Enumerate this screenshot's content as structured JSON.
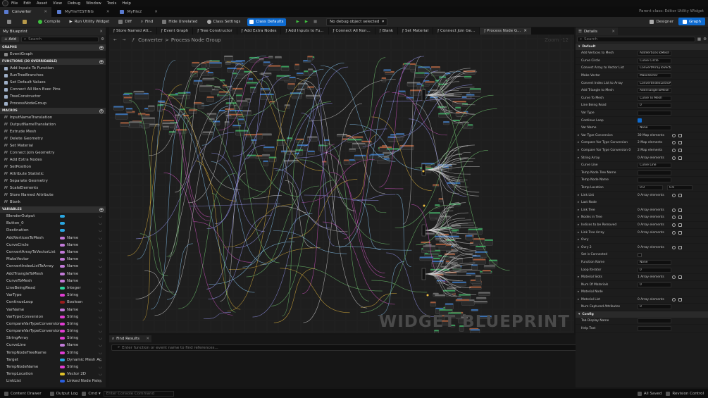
{
  "menu": [
    "File",
    "Edit",
    "Asset",
    "View",
    "Debug",
    "Window",
    "Tools",
    "Help"
  ],
  "doc_tabs": [
    {
      "label": "Converter",
      "active": true
    },
    {
      "label": "MyFileTESTING",
      "active": false
    },
    {
      "label": "MyFile2",
      "active": false
    }
  ],
  "parent_class": "Parent class: Editor Utility Widget",
  "toolbar": {
    "compile": "Compile",
    "run": "Run Utility Widget",
    "diff": "Diff",
    "find": "Find",
    "hide_unrelated": "Hide Unrelated",
    "class_settings": "Class Settings",
    "class_defaults": "Class Defaults",
    "debug_select": "No debug object selected",
    "designer": "Designer",
    "graph": "Graph"
  },
  "my_blueprint": {
    "tab": "My Blueprint",
    "add": "+ Add",
    "search_placeholder": "Search",
    "graphs_header": "GRAPHS",
    "graphs": [
      "EventGraph"
    ],
    "functions_header": "FUNCTIONS (30 OVERRIDABLE)",
    "functions": [
      "Add Inputs To Function",
      "RunTreeBranches",
      "Set Default Values",
      "Connect All Non Exec Pins",
      "TreeConstructor",
      "ProcessNodeGroup"
    ],
    "macros_header": "MACROS",
    "macros": [
      "InputNameTranslation",
      "OutputNameTranslation",
      "Extrude Mesh",
      "Delete Geometry",
      "Set Material",
      "Connect Join Geometry",
      "Add Extra Nodes",
      "SetPosition",
      "Attribute Statistic",
      "Separate Geometry",
      "ScaleElements",
      "Store Named Attribute",
      "Blank"
    ],
    "variables_header": "VARIABLES",
    "variables": [
      {
        "name": "BlenderOutput",
        "type": "",
        "color": "#2aa6e0"
      },
      {
        "name": "Button_0",
        "type": "",
        "color": "#2aa6e0"
      },
      {
        "name": "Destination",
        "type": "",
        "color": "#2aa6e0"
      },
      {
        "name": "AddVerticesToMesh",
        "type": "Name",
        "color": "#c27ad8"
      },
      {
        "name": "CurveCircle",
        "type": "Name",
        "color": "#c27ad8"
      },
      {
        "name": "ConvertArrayToVectorList",
        "type": "Name",
        "color": "#c27ad8"
      },
      {
        "name": "MakeVector",
        "type": "Name",
        "color": "#c27ad8"
      },
      {
        "name": "ConvertIndexListToArray",
        "type": "Name",
        "color": "#c27ad8"
      },
      {
        "name": "AddTriangleToMesh",
        "type": "Name",
        "color": "#c27ad8"
      },
      {
        "name": "CurveToMesh",
        "type": "Name",
        "color": "#c27ad8"
      },
      {
        "name": "LineBeingRead",
        "type": "Integer",
        "color": "#2fd39c"
      },
      {
        "name": "VarType",
        "type": "String",
        "color": "#e03dd2"
      },
      {
        "name": "ContinueLoop",
        "type": "Boolean",
        "color": "#9a1c1c"
      },
      {
        "name": "VarName",
        "type": "Name",
        "color": "#c27ad8"
      },
      {
        "name": "VarTypeConversion",
        "type": "String",
        "color": "#e03dd2"
      },
      {
        "name": "CompareVarTypeConversion",
        "type": "String",
        "color": "#e03dd2"
      },
      {
        "name": "CompareVarTypeConversion_0",
        "type": "String",
        "color": "#e03dd2"
      },
      {
        "name": "StringArray",
        "type": "String",
        "color": "#e03dd2"
      },
      {
        "name": "CurveLine",
        "type": "Name",
        "color": "#c27ad8"
      },
      {
        "name": "TempNodeTreeName",
        "type": "String",
        "color": "#e03dd2"
      },
      {
        "name": "Target",
        "type": "Dynamic Mesh Ac",
        "color": "#2aa6e0"
      },
      {
        "name": "TempNodeName",
        "type": "String",
        "color": "#e03dd2"
      },
      {
        "name": "TempLocation",
        "type": "Vector 2D",
        "color": "#e0c22a"
      },
      {
        "name": "LinkList",
        "type": "Linked Node Pairs",
        "color": "#2a5fe0"
      }
    ]
  },
  "graph": {
    "tabs": [
      "Store Named Att...",
      "Event Graph",
      "Tree Constructor",
      "Add Extra Nodes",
      "Add Inputs to Fu...",
      "Connect All Non...",
      "Blank",
      "Set Material",
      "Connect Join Ge...",
      "Process Node G..."
    ],
    "breadcrumb_root": "Converter",
    "breadcrumb_sep": ">",
    "breadcrumb_current": "Process Node Group",
    "zoom": "Zoom -12",
    "watermark": "WIDGET BLUEPRINT"
  },
  "find_results": {
    "tab": "Find Results",
    "placeholder": "Enter function or event name to find references..."
  },
  "details": {
    "tab": "Details",
    "search_placeholder": "Search",
    "default_header": "Default",
    "config_header": "Config",
    "rows": [
      {
        "label": "Add Vertices to Mesh",
        "value": "AddVerticesToMesh",
        "kind": "field"
      },
      {
        "label": "Curve Circle",
        "value": "Curve Circle",
        "kind": "field"
      },
      {
        "label": "Convert Array to Vector List",
        "value": "ConvertArrayToVectorList",
        "kind": "field"
      },
      {
        "label": "Make Vector",
        "value": "MakeVector",
        "kind": "field"
      },
      {
        "label": "Convert Index List to Array",
        "value": "ConvertIndexListToArray",
        "kind": "field"
      },
      {
        "label": "Add Triangle to Mesh",
        "value": "AddTriangleToMesh",
        "kind": "field"
      },
      {
        "label": "Curve To Mesh",
        "value": "Curve To Mesh",
        "kind": "field"
      },
      {
        "label": "Line Being Read",
        "value": "0",
        "kind": "field"
      },
      {
        "label": "Var Type",
        "value": "",
        "kind": "field"
      },
      {
        "label": "Continue Loop",
        "value": "",
        "kind": "check"
      },
      {
        "label": "Var Name",
        "value": "None",
        "kind": "field"
      },
      {
        "label": "Var Type Conversion",
        "value": "30 Map elements",
        "kind": "arr"
      },
      {
        "label": "Compare Var Type Conversion",
        "value": "2 Map elements",
        "kind": "arr"
      },
      {
        "label": "Compare Var Type Conversion 0",
        "value": "2 Map elements",
        "kind": "arr"
      },
      {
        "label": "String Array",
        "value": "0 Array elements",
        "kind": "arr"
      },
      {
        "label": "Curve Line",
        "value": "Curve Line",
        "kind": "field"
      },
      {
        "label": "Temp Node Tree Name",
        "value": "",
        "kind": "field"
      },
      {
        "label": "Temp Node Name",
        "value": "",
        "kind": "field"
      },
      {
        "label": "Temp Location",
        "value": "0.0",
        "value2": "0.0",
        "kind": "vec"
      },
      {
        "label": "Link List",
        "value": "0 Array elements",
        "kind": "arr"
      },
      {
        "label": "Last Node",
        "value": "",
        "kind": "plain"
      },
      {
        "label": "Link Tree",
        "value": "0 Array elements",
        "kind": "arr"
      },
      {
        "label": "Nodes in Tree",
        "value": "0 Array elements",
        "kind": "arr"
      },
      {
        "label": "Indices to be Removed",
        "value": "0 Array elements",
        "kind": "arr"
      },
      {
        "label": "Link Tree Array",
        "value": "0 Array elements",
        "kind": "arr"
      },
      {
        "label": "Ovry",
        "value": "",
        "kind": "plain"
      },
      {
        "label": "Ovry 2",
        "value": "0 Array elements",
        "kind": "arr"
      },
      {
        "label": "Set is Connected",
        "value": "",
        "kind": "checkoff"
      },
      {
        "label": "Function Name",
        "value": "None",
        "kind": "field"
      },
      {
        "label": "Loop Iterator",
        "value": "0",
        "kind": "field"
      },
      {
        "label": "Material Slots",
        "value": "1 Array elements",
        "kind": "arr"
      },
      {
        "label": "Num Of Materials",
        "value": "0",
        "kind": "field"
      },
      {
        "label": "Material Node",
        "value": "",
        "kind": "plain"
      },
      {
        "label": "Material List",
        "value": "0 Array elements",
        "kind": "arr"
      },
      {
        "label": "Num Captured Attributes",
        "value": "0",
        "kind": "field"
      }
    ],
    "config_rows": [
      {
        "label": "Tab Display Name",
        "value": ""
      },
      {
        "label": "Help Text",
        "value": ""
      }
    ]
  },
  "status": {
    "content_drawer": "Content Drawer",
    "output_log": "Output Log",
    "cmd": "Cmd",
    "cmd_placeholder": "Enter Console Command",
    "all_saved": "All Saved",
    "revision_control": "Revision Control"
  }
}
